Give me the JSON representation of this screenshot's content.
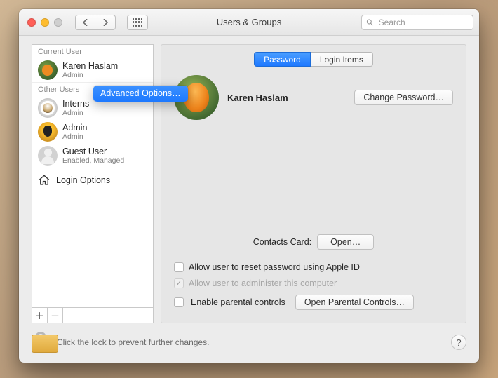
{
  "window": {
    "title": "Users & Groups",
    "search_placeholder": "Search"
  },
  "context_menu": {
    "label": "Advanced Options…"
  },
  "sidebar": {
    "current_header": "Current User",
    "other_header": "Other Users",
    "current": {
      "name": "Karen Haslam",
      "role": "Admin"
    },
    "others": [
      {
        "name": "Interns",
        "role": "Admin"
      },
      {
        "name": "Admin",
        "role": "Admin"
      },
      {
        "name": "Guest User",
        "role": "Enabled, Managed"
      }
    ],
    "login_options_label": "Login Options"
  },
  "tabs": {
    "password": "Password",
    "login_items": "Login Items"
  },
  "detail": {
    "display_name": "Karen Haslam",
    "change_password": "Change Password…",
    "contacts_card_label": "Contacts Card:",
    "open_button": "Open…",
    "allow_reset_label": "Allow user to reset password using Apple ID",
    "allow_admin_label": "Allow user to administer this computer",
    "parental_checkbox_label": "Enable parental controls",
    "parental_button": "Open Parental Controls…"
  },
  "lock": {
    "text": "Click the lock to prevent further changes.",
    "help": "?"
  },
  "colors": {
    "accent": "#1e78ff"
  }
}
